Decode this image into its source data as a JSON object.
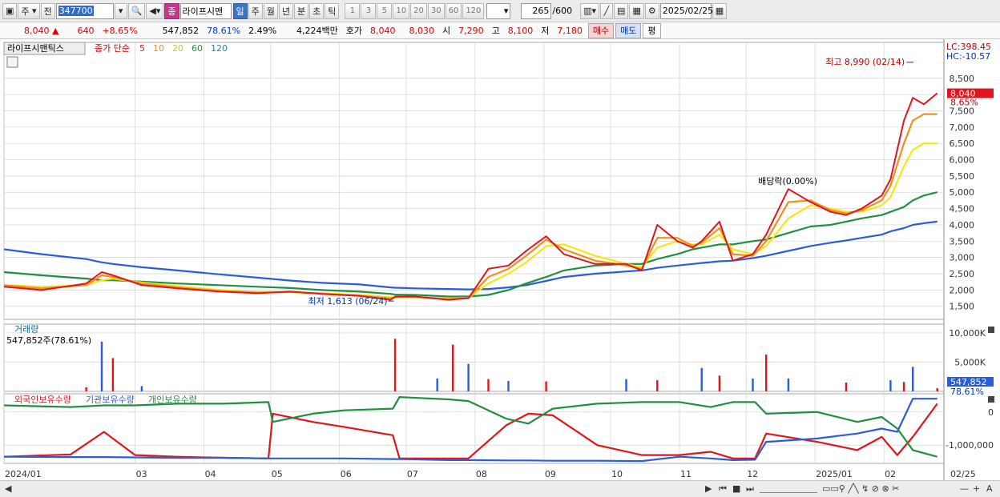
{
  "toolbar": {
    "market": "주",
    "prev": "전",
    "code": "347700",
    "stock_name": "라이프시맨",
    "tag_jong": "종",
    "periods": [
      "일",
      "주",
      "월",
      "년",
      "분",
      "초",
      "틱"
    ],
    "active_period": "일",
    "intervals": [
      "1",
      "3",
      "5",
      "10",
      "20",
      "30",
      "60",
      "120"
    ],
    "count": "265",
    "count_max": "/600",
    "date": "2025/02/25"
  },
  "quote": {
    "price": "8,040",
    "change": "640",
    "change_pct": "+8.65%",
    "volume": "547,852",
    "volume_ratio": "78.61%",
    "turnover": "2.49%",
    "amount": "4,224백만",
    "hoga_label": "호가",
    "ask": "8,040",
    "bid": "8,030",
    "open_label": "시",
    "open": "7,290",
    "high_label": "고",
    "high": "8,100",
    "low_label": "저",
    "low": "7,180",
    "buy_label": "매수",
    "sell_label": "매도",
    "pyeong_label": "평"
  },
  "chart_data": [
    {
      "type": "line",
      "title": "라이프시맨틱스",
      "ma_label": "종가 단순",
      "x": [
        "2024/01/02",
        "2024/01/19",
        "2024/02/08",
        "2024/02/15",
        "2024/02/20",
        "2024/03/04",
        "2024/03/20",
        "2024/04/08",
        "2024/04/25",
        "2024/05/10",
        "2024/05/24",
        "2024/06/10",
        "2024/06/24",
        "2024/06/26",
        "2024/07/05",
        "2024/07/20",
        "2024/07/29",
        "2024/08/07",
        "2024/08/16",
        "2024/08/24",
        "2024/09/02",
        "2024/09/10",
        "2024/09/24",
        "2024/10/08",
        "2024/10/15",
        "2024/10/22",
        "2024/10/31",
        "2024/11/07",
        "2024/11/11",
        "2024/11/19",
        "2024/11/25",
        "2024/12/04",
        "2024/12/10",
        "2024/12/20",
        "2024/12/30",
        "2025/01/08",
        "2025/01/15",
        "2025/01/22",
        "2025/01/31",
        "2025/02/04",
        "2025/02/10",
        "2025/02/14",
        "2025/02/19",
        "2025/02/25"
      ],
      "series": [
        {
          "name": "5",
          "color": "#e0161c",
          "values": [
            2100,
            2000,
            2200,
            2550,
            2450,
            2150,
            2050,
            1950,
            1900,
            1950,
            1880,
            1820,
            1700,
            1800,
            1800,
            1700,
            1750,
            2650,
            2750,
            3200,
            3650,
            3100,
            2800,
            2800,
            2600,
            4000,
            3500,
            3300,
            3500,
            4100,
            2900,
            3100,
            3700,
            5100,
            4700,
            4400,
            4300,
            4500,
            4900,
            5400,
            7200,
            7900,
            7700,
            8040
          ]
        },
        {
          "name": "10",
          "color": "#f0901e",
          "values": [
            2150,
            2050,
            2150,
            2450,
            2400,
            2200,
            2080,
            1970,
            1920,
            1940,
            1890,
            1830,
            1740,
            1780,
            1790,
            1720,
            1750,
            2400,
            2650,
            3050,
            3550,
            3250,
            2900,
            2750,
            2650,
            3600,
            3600,
            3350,
            3450,
            3900,
            3100,
            3050,
            3500,
            4700,
            4750,
            4450,
            4350,
            4450,
            4750,
            5200,
            6500,
            7200,
            7400,
            7400
          ]
        },
        {
          "name": "20",
          "color": "#f5e614",
          "values": [
            2150,
            2100,
            2150,
            2300,
            2350,
            2230,
            2120,
            2000,
            1940,
            1930,
            1900,
            1850,
            1780,
            1770,
            1780,
            1740,
            1760,
            2200,
            2500,
            2850,
            3350,
            3400,
            3050,
            2800,
            2700,
            3300,
            3500,
            3400,
            3400,
            3700,
            3250,
            3100,
            3350,
            4200,
            4600,
            4500,
            4400,
            4400,
            4600,
            4850,
            5800,
            6300,
            6500,
            6500
          ]
        },
        {
          "name": "60",
          "color": "#209040",
          "values": [
            2550,
            2450,
            2350,
            2300,
            2300,
            2260,
            2200,
            2150,
            2100,
            2060,
            2000,
            1950,
            1880,
            1860,
            1850,
            1800,
            1800,
            1850,
            2000,
            2200,
            2400,
            2600,
            2750,
            2800,
            2800,
            2950,
            3100,
            3250,
            3300,
            3400,
            3400,
            3500,
            3550,
            3750,
            3950,
            4000,
            4100,
            4200,
            4300,
            4400,
            4550,
            4750,
            4900,
            5000
          ]
        },
        {
          "name": "120",
          "color": "#2c5cd8",
          "values": [
            3250,
            3100,
            2950,
            2850,
            2800,
            2700,
            2600,
            2480,
            2380,
            2290,
            2220,
            2170,
            2080,
            2070,
            2050,
            2030,
            2020,
            2030,
            2080,
            2150,
            2280,
            2400,
            2500,
            2570,
            2600,
            2680,
            2750,
            2800,
            2830,
            2880,
            2900,
            2980,
            3050,
            3200,
            3350,
            3450,
            3520,
            3600,
            3700,
            3800,
            3900,
            4000,
            4050,
            4100
          ]
        }
      ],
      "xticks": [
        "2024/01",
        "03",
        "04",
        "05",
        "06",
        "07",
        "08",
        "09",
        "10",
        "11",
        "12",
        "2025/01",
        "02"
      ],
      "xtick_dates": [
        "2024/01/02",
        "2024/03/01",
        "2024/04/01",
        "2024/05/01",
        "2024/06/01",
        "2024/07/01",
        "2024/08/01",
        "2024/09/01",
        "2024/10/01",
        "2024/11/01",
        "2024/12/01",
        "2025/01/01",
        "2025/02/01"
      ],
      "yticks": [
        "1,500",
        "2,000",
        "2,500",
        "3,000",
        "3,500",
        "4,000",
        "4,500",
        "5,000",
        "5,500",
        "6,000",
        "6,500",
        "7,000",
        "7,500",
        "8,000",
        "8,500"
      ],
      "ylim": [
        1100,
        9600
      ],
      "last_price_label": "8,040",
      "last_pct_label": "8.65%",
      "lc_label": "LC:398.45",
      "hc_label": "HC:-10.57",
      "annotations": [
        {
          "text": "최고 8,990 (02/14)",
          "x": "2025/02/14",
          "y": 8990
        },
        {
          "text": "최저 1,613 (06/24)",
          "x": "2024/06/24",
          "y": 1613
        },
        {
          "text": "배당락(0.00%)",
          "x": "2024/12/10",
          "y": 5000
        }
      ]
    },
    {
      "type": "bar",
      "title": "거래량",
      "current_label": "547,852주(78.61%)",
      "x": [
        "2024/02/08",
        "2024/02/15",
        "2024/02/20",
        "2024/03/04",
        "2024/06/26",
        "2024/07/15",
        "2024/07/22",
        "2024/07/29",
        "2024/08/07",
        "2024/08/16",
        "2024/09/02",
        "2024/10/08",
        "2024/10/22",
        "2024/11/11",
        "2024/11/19",
        "2024/12/04",
        "2024/12/10",
        "2024/12/20",
        "2025/01/15",
        "2025/02/04",
        "2025/02/10",
        "2025/02/14",
        "2025/02/25"
      ],
      "values": [
        700,
        8500,
        5700,
        900,
        9000,
        2200,
        8000,
        4700,
        2100,
        1800,
        1700,
        2100,
        1900,
        4000,
        2700,
        2200,
        6300,
        2200,
        1500,
        1900,
        1600,
        4200,
        548
      ],
      "unit": "K",
      "yticks": [
        "5,000K",
        "10,000K"
      ],
      "ylim": [
        0,
        11500
      ],
      "last_label": "547,852",
      "last_pct_label": "78.61%"
    },
    {
      "type": "line",
      "series_labels": [
        "외국인보유수량",
        "기관보유수량",
        "개인보유수량"
      ],
      "x": [
        "2024/01/02",
        "2024/02/01",
        "2024/02/16",
        "2024/03/01",
        "2024/03/20",
        "2024/04/10",
        "2024/04/30",
        "2024/05/02",
        "2024/05/20",
        "2024/06/03",
        "2024/06/25",
        "2024/06/28",
        "2024/07/20",
        "2024/07/29",
        "2024/08/15",
        "2024/08/25",
        "2024/09/05",
        "2024/09/25",
        "2024/10/15",
        "2024/11/01",
        "2024/11/15",
        "2024/11/25",
        "2024/12/05",
        "2024/12/10",
        "2025/01/02",
        "2025/01/20",
        "2025/01/31",
        "2025/02/07",
        "2025/02/14",
        "2025/02/25"
      ],
      "series": [
        {
          "name": "외국인보유수량",
          "color": "#e0161c",
          "values": [
            -1350000,
            -1280000,
            -600000,
            -1300000,
            -1350000,
            -1380000,
            -1400000,
            -50000,
            -300000,
            -450000,
            -700000,
            -1400000,
            -1400000,
            -1400000,
            -400000,
            -50000,
            -100000,
            -1000000,
            -1300000,
            -1300000,
            -1200000,
            -1400000,
            -1400000,
            -650000,
            -900000,
            -1150000,
            -750000,
            -1300000,
            -750000,
            250000
          ]
        },
        {
          "name": "기관보유수량",
          "color": "#2c5cd8",
          "values": [
            -1350000,
            -1360000,
            -1360000,
            -1370000,
            -1380000,
            -1380000,
            -1400000,
            -1400000,
            -1400000,
            -1400000,
            -1420000,
            -1420000,
            -1450000,
            -1450000,
            -1460000,
            -1460000,
            -1470000,
            -1470000,
            -1480000,
            -1350000,
            -1400000,
            -1450000,
            -1440000,
            -900000,
            -800000,
            -650000,
            -500000,
            -600000,
            400000,
            400000
          ]
        },
        {
          "name": "개인보유수량",
          "color": "#209040",
          "values": [
            200000,
            150000,
            200000,
            200000,
            250000,
            250000,
            300000,
            -300000,
            -50000,
            50000,
            100000,
            450000,
            380000,
            330000,
            -200000,
            -350000,
            100000,
            250000,
            300000,
            300000,
            150000,
            300000,
            300000,
            -50000,
            0,
            -300000,
            -150000,
            -500000,
            -1150000,
            -1350000
          ]
        }
      ],
      "yticks": [
        "0",
        "-1,000,000"
      ],
      "ylim": [
        -1550000,
        550000
      ]
    }
  ],
  "scrollbar": {
    "last_date_label": "02/25",
    "controls": [
      "▶",
      "⏮",
      "■",
      "⏭"
    ],
    "zoom_minus": "—",
    "zoom_plus": "+",
    "font_label": "A"
  },
  "colors": {
    "up": "#e0161c",
    "down": "#2c5cd8",
    "grid": "#d3d3d3",
    "axis_text": "#333333"
  }
}
